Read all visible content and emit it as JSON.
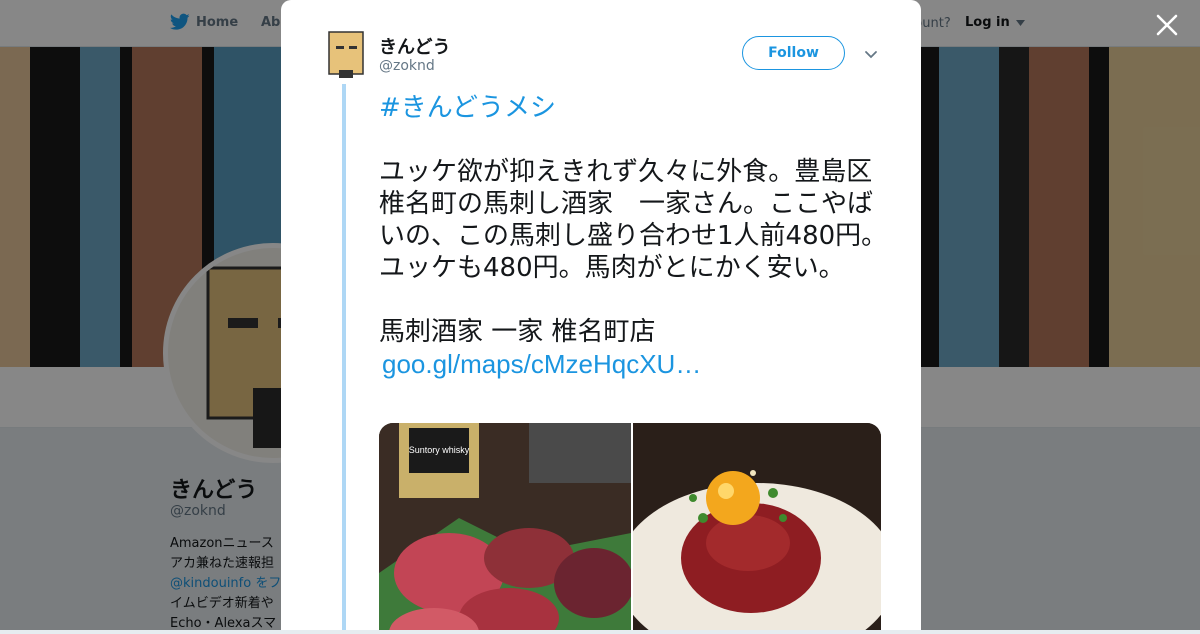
{
  "nav": {
    "home_label": "Home",
    "about_label": "Abo",
    "account_text": "ccount?",
    "login_label": "Log in"
  },
  "profile": {
    "name": "きんどう",
    "handle": "@zoknd",
    "bio_lines": [
      "Amazonニュース",
      "アカ兼ねた速報担",
      "@kindouinfo をフ",
      "イムビデオ新着や",
      "Echo・Alexaスマ"
    ]
  },
  "tweet": {
    "author_name": "きんどう",
    "author_handle": "@zoknd",
    "follow_label": "Follow",
    "hashtag": "#きんどうメシ",
    "body": "ユッケ欲が抑えきれず久々に外食。豊島区椎名町の馬刺し酒家　一家さん。ここやばいの、この馬刺し盛り合わせ1人前480円。ユッケも480円。馬肉がとにかく安い。",
    "place": "馬刺酒家 一家 椎名町店",
    "link": "goo.gl/maps/cMzeHqcXU…"
  },
  "media": {
    "photo1_label": "Suntory whisky",
    "photo2_alt": ""
  },
  "colors": {
    "link": "#1b95e0",
    "thread": "#aed7f5",
    "overlay": "rgba(0,0,0,0.47)"
  },
  "icons": [
    "twitter-bird-icon",
    "caret-down-icon",
    "close-icon",
    "chevron-down-icon"
  ]
}
